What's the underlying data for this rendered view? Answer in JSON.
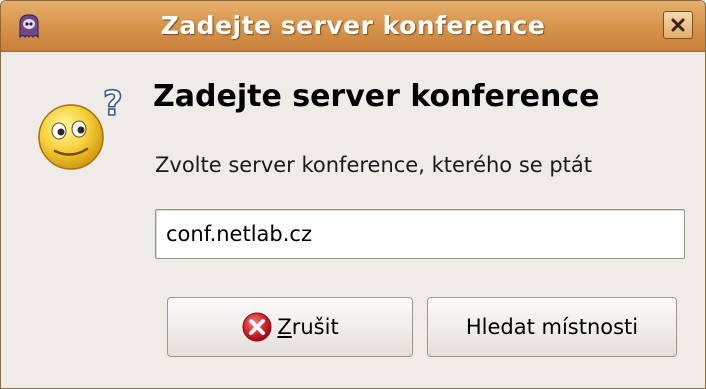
{
  "window": {
    "title": "Zadejte server konference"
  },
  "dialog": {
    "heading": "Zadejte server konference",
    "subtext": "Zvolte server konference, kterého se ptát",
    "server_input_value": "conf.netlab.cz"
  },
  "buttons": {
    "cancel_mnemonic": "Z",
    "cancel_rest": "rušit",
    "search_label": "Hledat místnosti"
  },
  "icons": {
    "app": "pidgin-purple-icon",
    "dialog": "question-smiley-icon",
    "close": "close-icon",
    "cancel": "cancel-icon"
  },
  "colors": {
    "titlebar": "#d8964e",
    "background": "#efebe7",
    "cancel_red": "#d6252a"
  }
}
